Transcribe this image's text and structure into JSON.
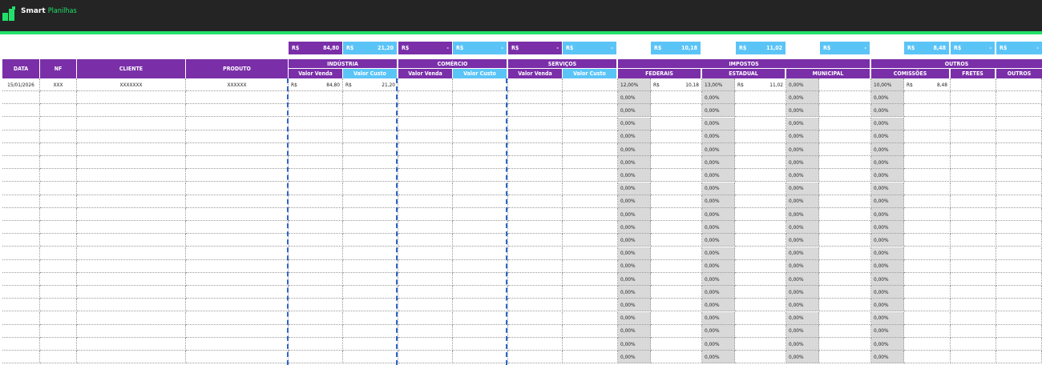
{
  "app": {
    "brand_bold": "Smart",
    "brand_light": "Planilhas"
  },
  "colors": {
    "purple": "#7a2fa8",
    "blue": "#5bc4f7",
    "green": "#22e06a",
    "topbar": "#242424",
    "gray": "#d9d9d9"
  },
  "currency": "R$",
  "summary": {
    "industria_venda": "84,80",
    "industria_custo": "21,20",
    "comercio_venda": "-",
    "comercio_custo": "-",
    "servicos_venda": "-",
    "servicos_custo": "-",
    "federais": "10,18",
    "estadual": "11,02",
    "municipal": "-",
    "comissoes": "8,48",
    "fretes": "-",
    "outros": "-"
  },
  "headers": {
    "data": "DATA",
    "nf": "NF",
    "cliente": "CLIENTE",
    "produto": "PRODUTO",
    "industria": "INDÚSTRIA",
    "comercio": "COMÉRCIO",
    "servicos": "SERVIÇOS",
    "impostos": "IMPOSTOS",
    "outros_group": "OUTROS",
    "valor_venda": "Valor Venda",
    "valor_custo": "Valor Custo",
    "federais": "FEDERAIS",
    "estadual": "ESTADUAL",
    "municipal": "MUNICIPAL",
    "comissoes": "COMISSÕES",
    "fretes": "FRETES",
    "outros": "OUTROS"
  },
  "first_row": {
    "data": "15/01/2026",
    "nf": "XXX",
    "cliente": "XXXXXXX",
    "produto": "XXXXXX",
    "industria_venda": "84,80",
    "industria_custo": "21,20",
    "federais_valor": "10,18",
    "estadual_valor": "11,02",
    "comissoes_valor": "8,48"
  },
  "rates": {
    "federais": [
      "12,00%",
      "0,00%",
      "0,00%",
      "0,00%",
      "0,00%",
      "0,00%",
      "0,00%",
      "0,00%",
      "0,00%",
      "0,00%",
      "0,00%",
      "0,00%",
      "0,00%",
      "0,00%",
      "0,00%",
      "0,00%",
      "0,00%",
      "0,00%",
      "0,00%",
      "0,00%",
      "0,00%",
      "0,00%"
    ],
    "estadual": [
      "13,00%",
      "0,00%",
      "0,00%",
      "0,00%",
      "0,00%",
      "0,00%",
      "0,00%",
      "0,00%",
      "0,00%",
      "0,00%",
      "0,00%",
      "0,00%",
      "0,00%",
      "0,00%",
      "0,00%",
      "0,00%",
      "0,00%",
      "0,00%",
      "0,00%",
      "0,00%",
      "0,00%",
      "0,00%"
    ],
    "municipal": [
      "0,00%",
      "0,00%",
      "0,00%",
      "0,00%",
      "0,00%",
      "0,00%",
      "0,00%",
      "0,00%",
      "0,00%",
      "0,00%",
      "0,00%",
      "0,00%",
      "0,00%",
      "0,00%",
      "0,00%",
      "0,00%",
      "0,00%",
      "0,00%",
      "0,00%",
      "0,00%",
      "0,00%",
      "0,00%"
    ],
    "comissoes": [
      "10,00%",
      "0,00%",
      "0,00%",
      "0,00%",
      "0,00%",
      "0,00%",
      "0,00%",
      "0,00%",
      "0,00%",
      "0,00%",
      "0,00%",
      "0,00%",
      "0,00%",
      "0,00%",
      "0,00%",
      "0,00%",
      "0,00%",
      "0,00%",
      "0,00%",
      "0,00%",
      "0,00%",
      "0,00%"
    ]
  }
}
